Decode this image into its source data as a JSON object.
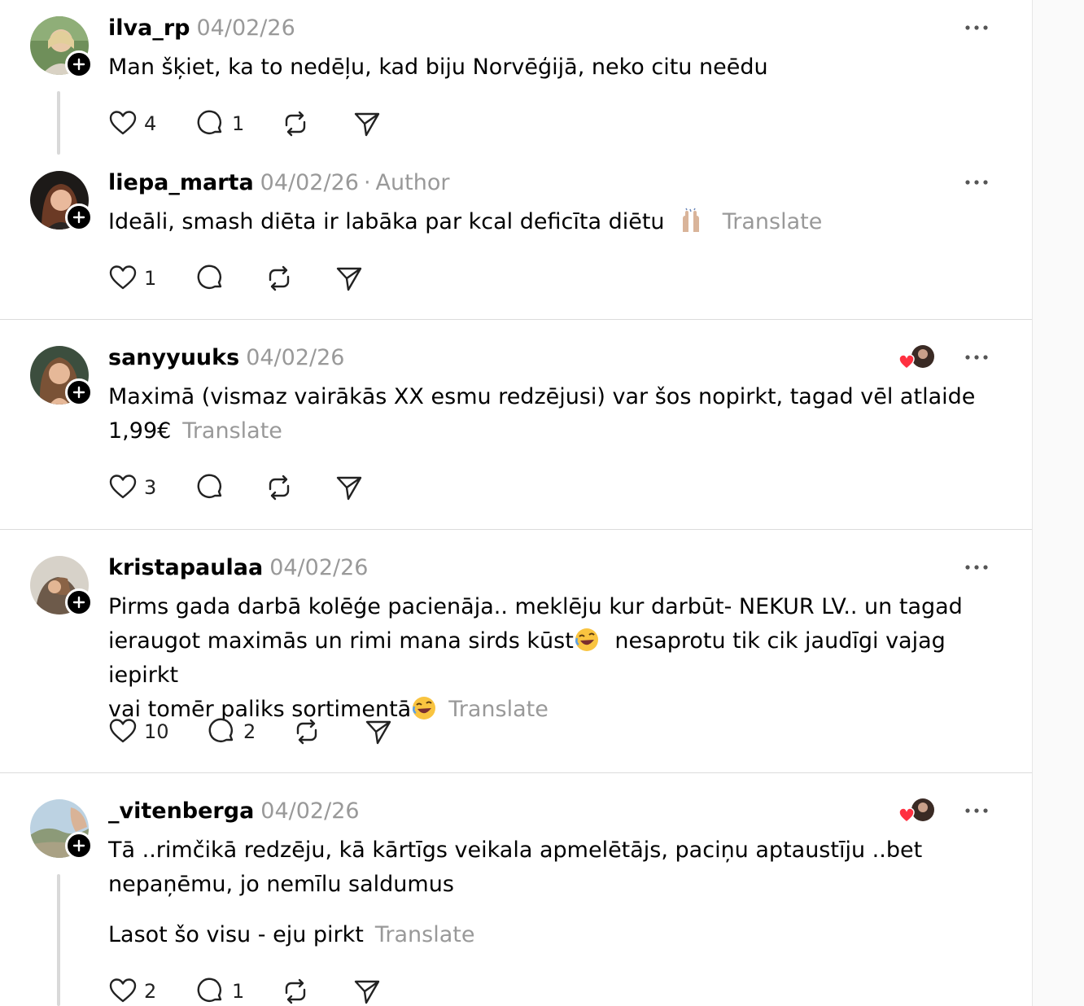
{
  "posts": [
    {
      "username": "ilva_rp",
      "date": "04/02/26",
      "text": "Man šķiet, ka to nedēļu, kad biju Norvēģijā, neko citu neēdu",
      "likes": "4",
      "replies": "1"
    },
    {
      "username": "liepa_marta",
      "date": "04/02/26",
      "separator": "·",
      "role": "Author",
      "text": "Ideāli, smash diēta ir labāka par kcal deficīta diētu",
      "emoji": "raising-hands-icon",
      "translate": "Translate",
      "likes": "1"
    },
    {
      "username": "sanyyuuks",
      "date": "04/02/26",
      "text_line1": "Maximā (vismaz vairākās XX esmu redzējusi) var šos nopirkt, tagad vēl atlaide",
      "text_line2": "1,99€",
      "translate": "Translate",
      "likes": "3"
    },
    {
      "username": "kristapaulaa",
      "date": "04/02/26",
      "text_line1": "Pirms gada darbā kolēģe pacienāja.. meklēju kur darbūt- NEKUR LV.. un tagad",
      "text_line2a": "ieraugot maximās un rimi mana sirds kūst",
      "text_line2b": "nesaprotu tik cik jaudīgi vajag iepirkt",
      "text_line3": "vai tomēr paliks sortimentā",
      "emoji": "rolling-laughing-icon",
      "translate": "Translate",
      "likes": "10",
      "replies": "2"
    },
    {
      "username": "_vitenberga",
      "date": "04/02/26",
      "text_line1": "Tā ..rimčikā redzēju, kā kārtīgs veikala apmelētājs, paciņu aptaustīju ..bet",
      "text_line2": "nepaņēmu, jo nemīlu saldumus",
      "text_line3": "Lasot šo visu - eju pirkt",
      "translate": "Translate",
      "likes": "2",
      "replies": "1"
    }
  ],
  "colors": {
    "text": "#000000",
    "muted": "#999999",
    "divider": "#dcdcdc",
    "liked_heart": "#ff3040"
  }
}
